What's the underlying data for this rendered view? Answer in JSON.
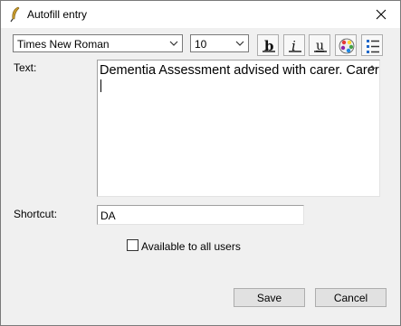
{
  "window": {
    "title": "Autofill entry"
  },
  "font": {
    "family": "Times New Roman",
    "size": "10"
  },
  "icons": {
    "app": "quill-pen-icon",
    "close": "close-icon",
    "bold": "bold-icon",
    "italic": "italic-icon",
    "underline": "underline-icon",
    "color": "color-palette-icon",
    "list": "list-icon"
  },
  "text_field": {
    "label": "Text:",
    "value": "Dementia Assessment advised with carer. Carer is"
  },
  "shortcut": {
    "label": "Shortcut:",
    "value": "DA"
  },
  "available_to_all": {
    "label": "Available to all users",
    "checked": false
  },
  "buttons": {
    "save": "Save",
    "cancel": "Cancel"
  },
  "colors": {
    "border": "#7a7a7a",
    "button_face": "#e1e1e1",
    "dialog_bg": "#f0f0f0"
  }
}
